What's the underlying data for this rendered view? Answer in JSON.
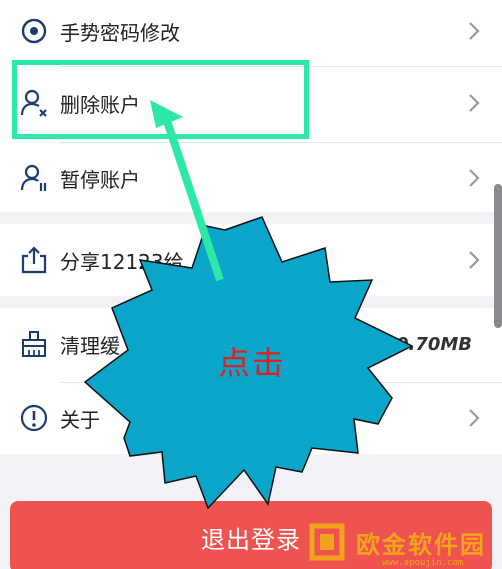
{
  "settings": {
    "items": [
      {
        "label": "手势密码修改",
        "icon": "radio-target-icon"
      },
      {
        "label": "删除账户",
        "icon": "user-remove-icon"
      },
      {
        "label": "暂停账户",
        "icon": "user-pause-icon"
      },
      {
        "label": "分享12123给",
        "icon": "share-icon"
      },
      {
        "label": "清理缓",
        "icon": "broom-icon",
        "value": "0.70MB"
      },
      {
        "label": "关于",
        "icon": "info-icon"
      }
    ]
  },
  "logout_label": "退出登录",
  "annotation": {
    "text": "点击",
    "highlight_color": "#2de8a6",
    "burst_color": "#0aa5c9"
  },
  "watermark": {
    "text": "欧金软件园",
    "url": "www.apoujin.com"
  },
  "colors": {
    "logout": "#ef5350",
    "background": "#f2f2f6"
  }
}
